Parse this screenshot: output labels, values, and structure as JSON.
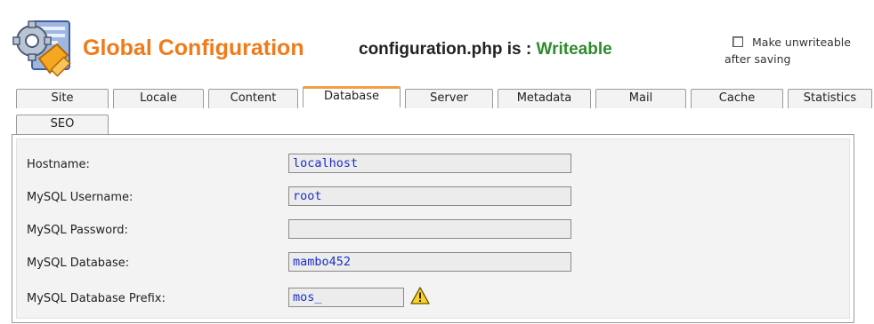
{
  "header": {
    "title": "Global Configuration",
    "config_file_label": "configuration.php is :",
    "config_file_state": "Writeable",
    "unwriteable_label": "Make unwriteable after saving",
    "unwriteable_checked": false
  },
  "tabs": [
    {
      "label": "Site",
      "active": false
    },
    {
      "label": "Locale",
      "active": false
    },
    {
      "label": "Content",
      "active": false
    },
    {
      "label": "Database",
      "active": true
    },
    {
      "label": "Server",
      "active": false
    },
    {
      "label": "Metadata",
      "active": false
    },
    {
      "label": "Mail",
      "active": false
    },
    {
      "label": "Cache",
      "active": false
    },
    {
      "label": "Statistics",
      "active": false
    },
    {
      "label": "SEO",
      "active": false
    }
  ],
  "database": {
    "hostname": {
      "label": "Hostname:",
      "value": "localhost"
    },
    "username": {
      "label": "MySQL Username:",
      "value": "root"
    },
    "password": {
      "label": "MySQL Password:",
      "value": ""
    },
    "db_name": {
      "label": "MySQL Database:",
      "value": "mambo452"
    },
    "prefix": {
      "label": "MySQL Database Prefix:",
      "value": "mos_"
    }
  },
  "icons": {
    "logo": "config-tools-icon",
    "prefix_warning": "warning-icon"
  },
  "colors": {
    "title": "#f07b18",
    "writeable": "#2e8b2e",
    "field_text": "#1a2ec8",
    "active_tab_accent": "#f0a040"
  }
}
